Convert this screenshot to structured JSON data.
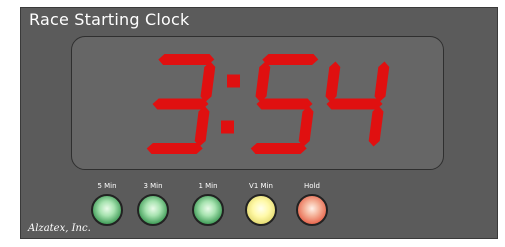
{
  "window": {
    "title": "Race Starting Clock"
  },
  "clock": {
    "time": "3:54",
    "minutes": "3",
    "seconds_tens": "5",
    "seconds_ones": "4",
    "segment_color": "#e01010",
    "display_bg": "#666666"
  },
  "buttons": [
    {
      "label": "5 Min",
      "color": "green"
    },
    {
      "label": "3 Min",
      "color": "green"
    },
    {
      "label": "1 Min",
      "color": "green"
    },
    {
      "label": "V1 Min",
      "color": "yellow"
    },
    {
      "label": "Hold",
      "color": "red"
    }
  ],
  "footer": {
    "company": "Alzatex, Inc."
  }
}
